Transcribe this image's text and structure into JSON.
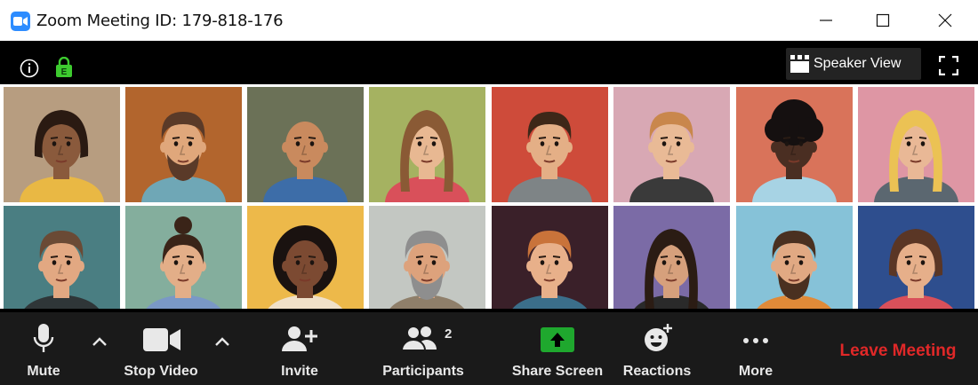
{
  "window": {
    "title": "Zoom Meeting ID: 179-818-176"
  },
  "header": {
    "speaker_view_label": "Speaker View",
    "encryption_badge": "E"
  },
  "toolbar": {
    "mute_label": "Mute",
    "stop_video_label": "Stop Video",
    "invite_label": "Invite",
    "participants_label": "Participants",
    "participants_count": "2",
    "share_screen_label": "Share Screen",
    "reactions_label": "Reactions",
    "more_label": "More",
    "leave_label": "Leave Meeting"
  },
  "colors": {
    "brand_blue": "#2D8CFF",
    "share_green": "#1FA82E",
    "leave_red": "#E02828",
    "lock_green": "#3DCB2F"
  },
  "participants": [
    {
      "bg": "#B79D80",
      "skin": "#8A5A3C",
      "hair": "#2A1A12",
      "shirt": "#E9B844",
      "style": "bob"
    },
    {
      "bg": "#B2652D",
      "skin": "#E0A77B",
      "hair": "#5A3A28",
      "shirt": "#6FA7B6",
      "style": "beard"
    },
    {
      "bg": "#6B7157",
      "skin": "#C98A5E",
      "hair": "#3A2818",
      "shirt": "#3D6DA8",
      "style": "bald"
    },
    {
      "bg": "#A5B261",
      "skin": "#E8B892",
      "hair": "#8A5A35",
      "shirt": "#D9505A",
      "style": "long"
    },
    {
      "bg": "#CE4B3A",
      "skin": "#E4AF86",
      "hair": "#3D2718",
      "shirt": "#7E8486",
      "style": "short"
    },
    {
      "bg": "#D8A8B4",
      "skin": "#E9BA96",
      "hair": "#C9874C",
      "shirt": "#3A3A3A",
      "style": "short"
    },
    {
      "bg": "#D9735A",
      "skin": "#4A2E22",
      "hair": "#151010",
      "shirt": "#A7D3E4",
      "style": "afro"
    },
    {
      "bg": "#DE96A4",
      "skin": "#E9B896",
      "hair": "#EBC254",
      "shirt": "#5B6770",
      "style": "long"
    },
    {
      "bg": "#4A7E82",
      "skin": "#E2A882",
      "hair": "#6A4A35",
      "shirt": "#2F3638",
      "style": "short"
    },
    {
      "bg": "#84AE9D",
      "skin": "#E3AE88",
      "hair": "#3A2418",
      "shirt": "#7A98C6",
      "style": "bun"
    },
    {
      "bg": "#EDB94A",
      "skin": "#7C4A32",
      "hair": "#1A1210",
      "shirt": "#F0E0C8",
      "style": "curly"
    },
    {
      "bg": "#C3C7C2",
      "skin": "#DDA27C",
      "hair": "#8E8E8E",
      "shirt": "#8F7F6A",
      "style": "beard"
    },
    {
      "bg": "#3A2029",
      "skin": "#E8B08A",
      "hair": "#C9733A",
      "shirt": "#3B6E8A",
      "style": "short"
    },
    {
      "bg": "#7B6BA6",
      "skin": "#D6A07C",
      "hair": "#2B1C14",
      "shirt": "#2A2A2A",
      "style": "long"
    },
    {
      "bg": "#86C2D8",
      "skin": "#E1A983",
      "hair": "#4A3020",
      "shirt": "#E08A38",
      "style": "beard"
    },
    {
      "bg": "#2E4E8E",
      "skin": "#E6AF8A",
      "hair": "#5A3625",
      "shirt": "#D9505A",
      "style": "bob"
    }
  ]
}
